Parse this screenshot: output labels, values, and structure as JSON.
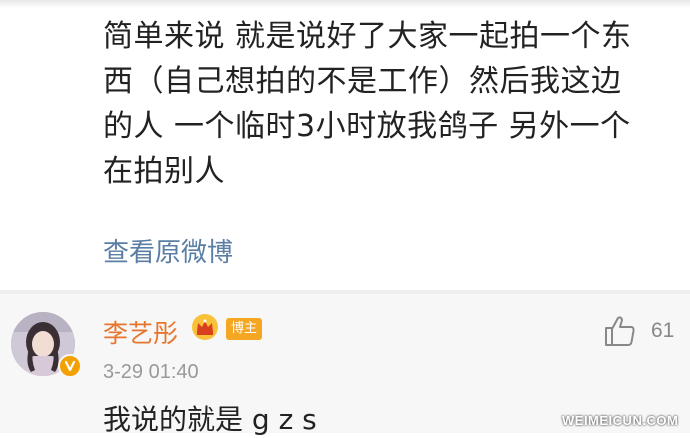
{
  "post": {
    "text": "简单来说 就是说好了大家一起拍一个东\n西（自己想拍的不是工作）然后我这边\n的人 一个临时3小时放我鸽子 另外一个\n在拍别人",
    "view_original_label": "查看原微博"
  },
  "comment": {
    "username": "李艺彤",
    "badge_label": "博主",
    "timestamp": "3-29 01:40",
    "text": "我说的就是 g z s",
    "like_count": "61",
    "avatar_badge_glyph": "V"
  },
  "watermark": "WEIMEICUN.COM",
  "colors": {
    "link": "#5b7ea4",
    "username": "#e8752d",
    "badge": "#f5a623",
    "comment_bg": "#f7f7f7"
  },
  "icons": [
    "crown-icon",
    "like-icon",
    "verified-icon"
  ]
}
